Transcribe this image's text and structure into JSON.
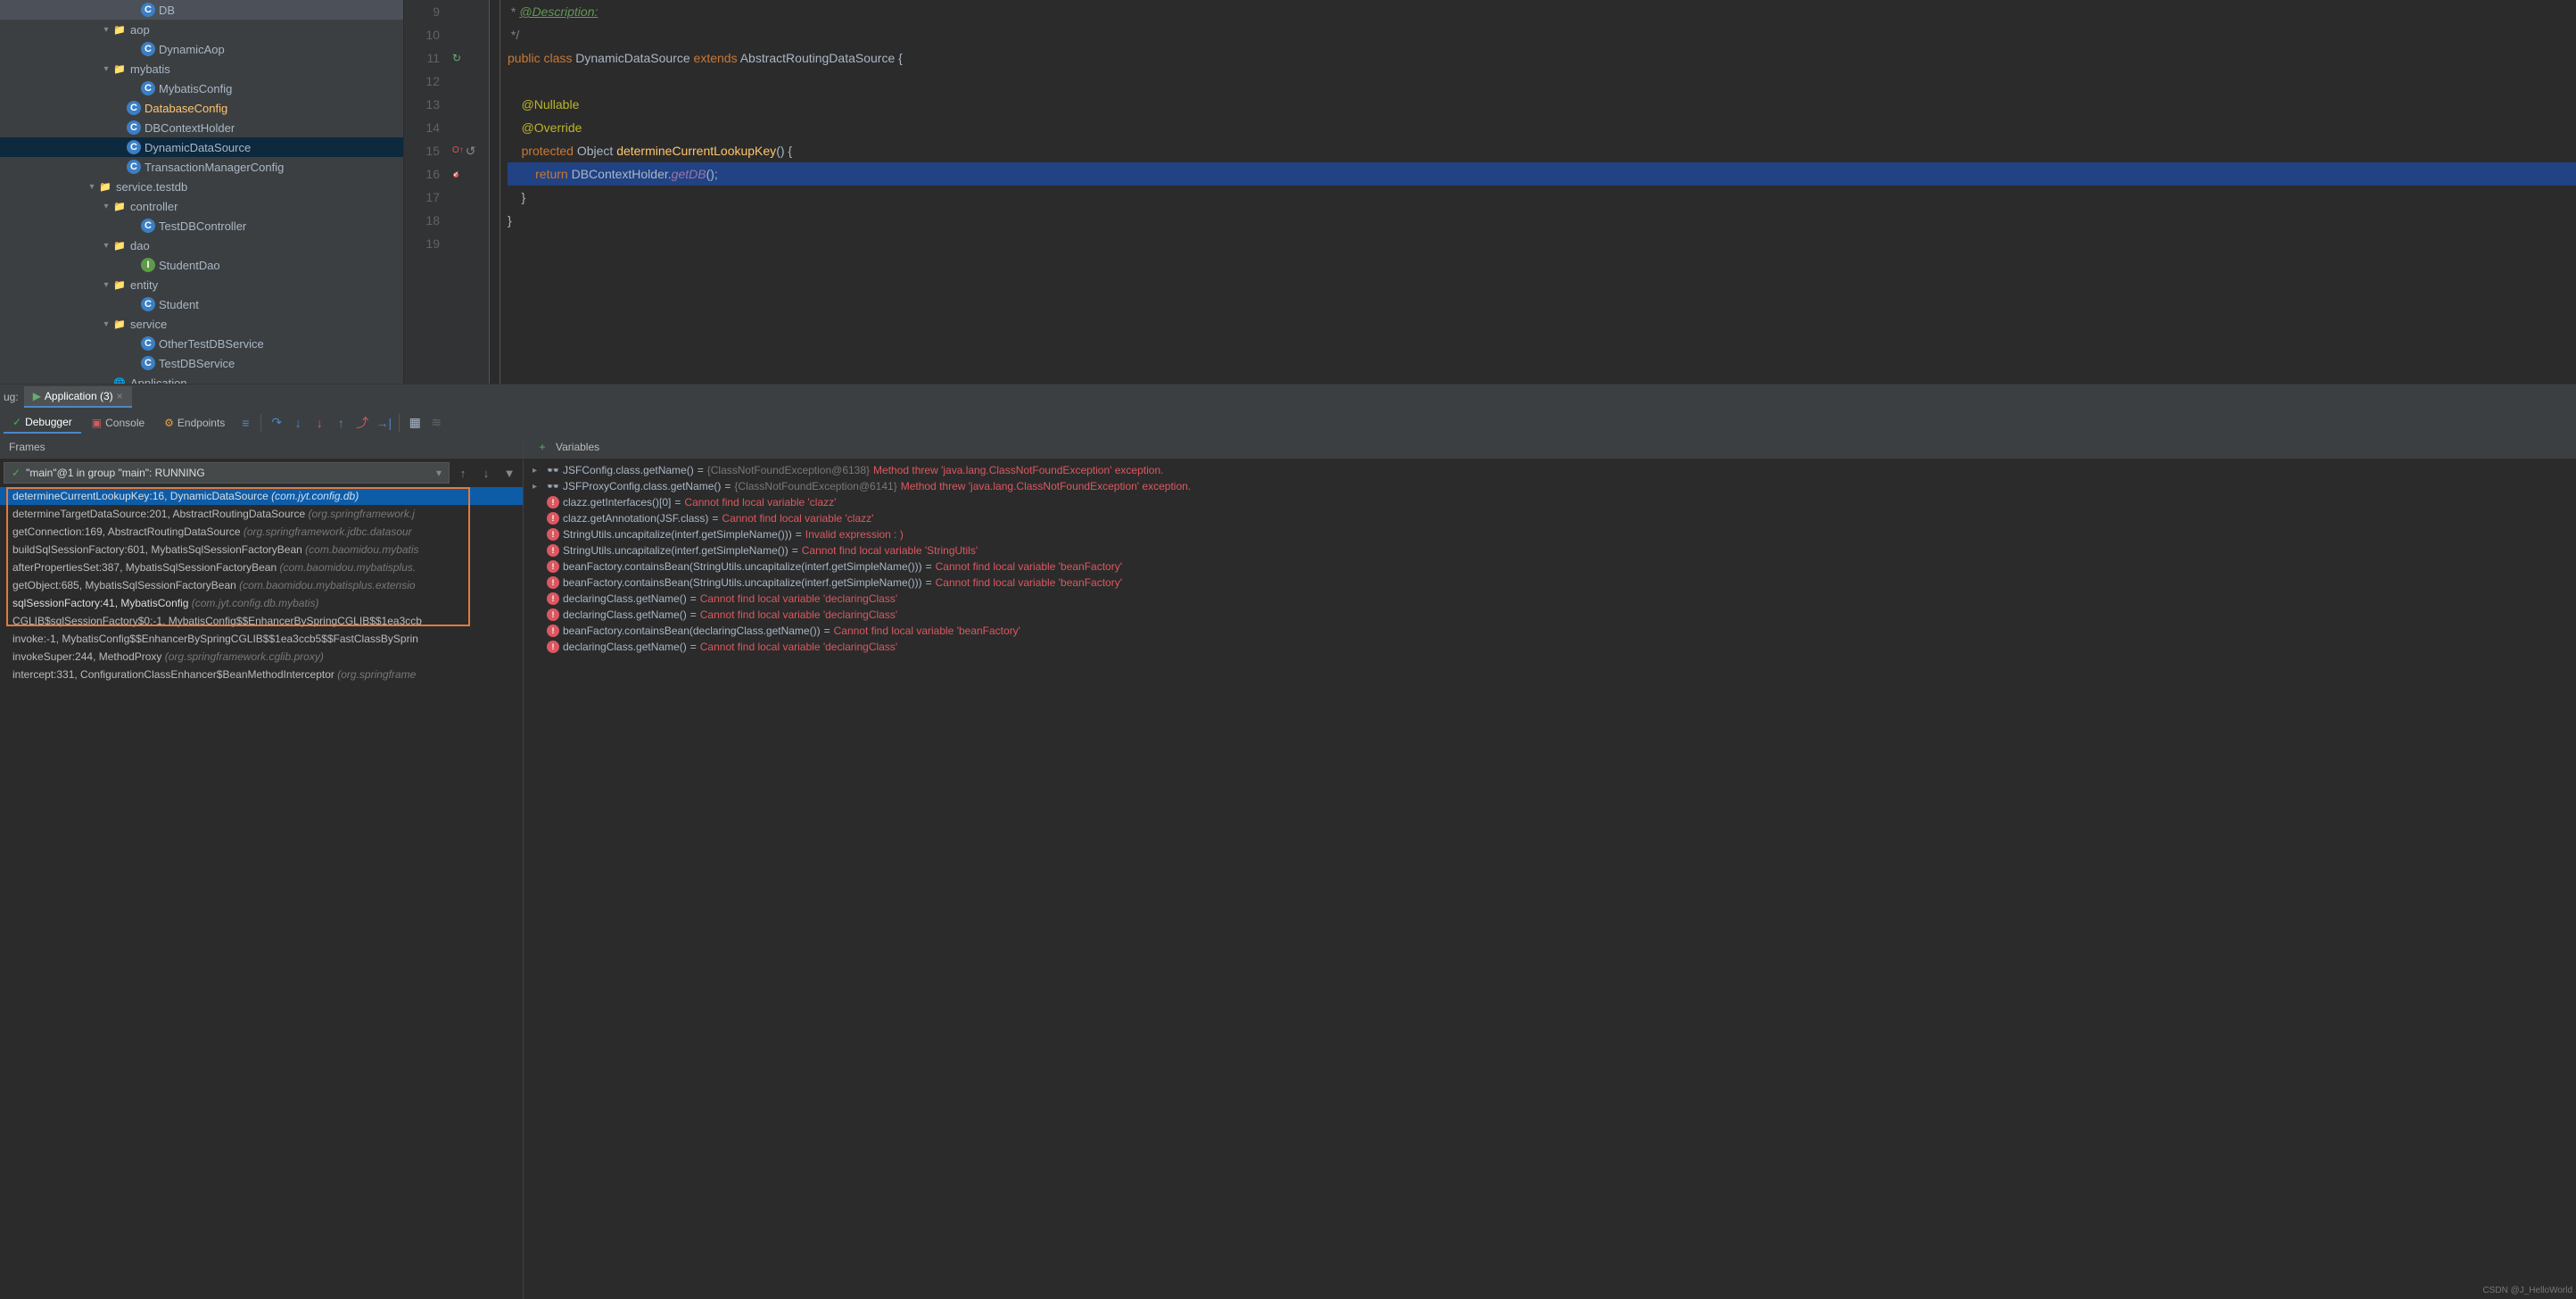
{
  "tree": {
    "items": [
      {
        "indent": 9,
        "chevron": "",
        "icon": "class-c",
        "iconText": "C",
        "label": "DB"
      },
      {
        "indent": 7,
        "chevron": "▾",
        "icon": "folder",
        "iconText": "📁",
        "label": "aop"
      },
      {
        "indent": 9,
        "chevron": "",
        "icon": "class-c",
        "iconText": "C",
        "label": "DynamicAop"
      },
      {
        "indent": 7,
        "chevron": "▾",
        "icon": "folder",
        "iconText": "📁",
        "label": "mybatis"
      },
      {
        "indent": 9,
        "chevron": "",
        "icon": "class-c",
        "iconText": "C",
        "label": "MybatisConfig"
      },
      {
        "indent": 8,
        "chevron": "",
        "icon": "class-c",
        "iconText": "C",
        "label": "DatabaseConfig",
        "highlighted": true
      },
      {
        "indent": 8,
        "chevron": "",
        "icon": "class-c",
        "iconText": "C",
        "label": "DBContextHolder"
      },
      {
        "indent": 8,
        "chevron": "",
        "icon": "class-c",
        "iconText": "C",
        "label": "DynamicDataSource",
        "selected": true
      },
      {
        "indent": 8,
        "chevron": "",
        "icon": "class-c",
        "iconText": "C",
        "label": "TransactionManagerConfig"
      },
      {
        "indent": 6,
        "chevron": "▾",
        "icon": "folder",
        "iconText": "📁",
        "label": "service.testdb"
      },
      {
        "indent": 7,
        "chevron": "▾",
        "icon": "folder",
        "iconText": "📁",
        "label": "controller"
      },
      {
        "indent": 9,
        "chevron": "",
        "icon": "class-c",
        "iconText": "C",
        "label": "TestDBController"
      },
      {
        "indent": 7,
        "chevron": "▾",
        "icon": "folder",
        "iconText": "📁",
        "label": "dao"
      },
      {
        "indent": 9,
        "chevron": "",
        "icon": "interface",
        "iconText": "I",
        "label": "StudentDao"
      },
      {
        "indent": 7,
        "chevron": "▾",
        "icon": "folder",
        "iconText": "📁",
        "label": "entity"
      },
      {
        "indent": 9,
        "chevron": "",
        "icon": "class-c",
        "iconText": "C",
        "label": "Student"
      },
      {
        "indent": 7,
        "chevron": "▾",
        "icon": "folder",
        "iconText": "📁",
        "label": "service"
      },
      {
        "indent": 9,
        "chevron": "",
        "icon": "class-c",
        "iconText": "C",
        "label": "OtherTestDBService"
      },
      {
        "indent": 9,
        "chevron": "",
        "icon": "class-c",
        "iconText": "C",
        "label": "TestDBService"
      },
      {
        "indent": 7,
        "chevron": "",
        "icon": "special",
        "iconText": "▶",
        "label": "Application"
      }
    ]
  },
  "editor": {
    "lines": [
      {
        "num": "9",
        "tokens": [
          {
            "t": "comment",
            "v": " * "
          },
          {
            "t": "doc-tag",
            "v": "@Description:"
          }
        ]
      },
      {
        "num": "10",
        "tokens": [
          {
            "t": "comment",
            "v": " */"
          }
        ]
      },
      {
        "num": "11",
        "gutter": "impl-down",
        "tokens": [
          {
            "t": "keyword",
            "v": "public class "
          },
          {
            "t": "class",
            "v": "DynamicDataSource "
          },
          {
            "t": "keyword",
            "v": "extends "
          },
          {
            "t": "class",
            "v": "AbstractRoutingDataSource {"
          }
        ]
      },
      {
        "num": "12",
        "tokens": []
      },
      {
        "num": "13",
        "tokens": [
          {
            "t": "plain",
            "v": "    "
          },
          {
            "t": "anno",
            "v": "@Nullable"
          }
        ]
      },
      {
        "num": "14",
        "tokens": [
          {
            "t": "plain",
            "v": "    "
          },
          {
            "t": "anno",
            "v": "@Override"
          }
        ]
      },
      {
        "num": "15",
        "gutter": "override",
        "tokens": [
          {
            "t": "plain",
            "v": "    "
          },
          {
            "t": "keyword",
            "v": "protected "
          },
          {
            "t": "class",
            "v": "Object "
          },
          {
            "t": "method",
            "v": "determineCurrentLookupKey"
          },
          {
            "t": "class",
            "v": "() {"
          }
        ]
      },
      {
        "num": "16",
        "gutter": "breakpoint",
        "highlighted": true,
        "tokens": [
          {
            "t": "plain",
            "v": "        "
          },
          {
            "t": "return",
            "v": "return "
          },
          {
            "t": "class",
            "v": "DBContextHolder."
          },
          {
            "t": "static",
            "v": "getDB"
          },
          {
            "t": "class",
            "v": "();"
          }
        ]
      },
      {
        "num": "17",
        "tokens": [
          {
            "t": "plain",
            "v": "    }"
          }
        ]
      },
      {
        "num": "18",
        "tokens": [
          {
            "t": "plain",
            "v": "}"
          }
        ]
      },
      {
        "num": "19",
        "tokens": []
      }
    ]
  },
  "debug_tab_prefix": "ug:",
  "debug_tab": "Application (3)",
  "toolbar_tabs": [
    "Debugger",
    "Console",
    "Endpoints"
  ],
  "frames": {
    "title": "Frames",
    "thread": "\"main\"@1 in group \"main\": RUNNING",
    "rows": [
      {
        "loc": "determineCurrentLookupKey:16, DynamicDataSource",
        "pkg": "(com.jyt.config.db)",
        "selected": true,
        "bold": true
      },
      {
        "loc": "determineTargetDataSource:201, AbstractRoutingDataSource",
        "pkg": "(org.springframework.j"
      },
      {
        "loc": "getConnection:169, AbstractRoutingDataSource",
        "pkg": "(org.springframework.jdbc.datasour"
      },
      {
        "loc": "buildSqlSessionFactory:601, MybatisSqlSessionFactoryBean",
        "pkg": "(com.baomidou.mybatis"
      },
      {
        "loc": "afterPropertiesSet:387, MybatisSqlSessionFactoryBean",
        "pkg": "(com.baomidou.mybatisplus."
      },
      {
        "loc": "getObject:685, MybatisSqlSessionFactoryBean",
        "pkg": "(com.baomidou.mybatisplus.extensio"
      },
      {
        "loc": "sqlSessionFactory:41, MybatisConfig",
        "pkg": "(com.jyt.config.db.mybatis)",
        "bold": true
      },
      {
        "loc": "CGLIB$sqlSessionFactory$0:-1, MybatisConfig$$EnhancerBySpringCGLIB$$1ea3ccb",
        "pkg": ""
      },
      {
        "loc": "invoke:-1, MybatisConfig$$EnhancerBySpringCGLIB$$1ea3ccb5$$FastClassBySprin",
        "pkg": ""
      },
      {
        "loc": "invokeSuper:244, MethodProxy",
        "pkg": "(org.springframework.cglib.proxy)"
      },
      {
        "loc": "intercept:331, ConfigurationClassEnhancer$BeanMethodInterceptor",
        "pkg": "(org.springframe"
      }
    ]
  },
  "variables": {
    "title": "Variables",
    "rows": [
      {
        "chevron": "▸",
        "icon": "glasses",
        "expr": "JSFConfig.class.getName()",
        "op": " = ",
        "obj": "{ClassNotFoundException@6138}",
        "err": " Method threw 'java.lang.ClassNotFoundException' exception."
      },
      {
        "chevron": "▸",
        "icon": "glasses",
        "expr": "JSFProxyConfig.class.getName()",
        "op": " = ",
        "obj": "{ClassNotFoundException@6141}",
        "err": " Method threw 'java.lang.ClassNotFoundException' exception."
      },
      {
        "chevron": "",
        "icon": "error",
        "expr": "clazz.getInterfaces()[0]",
        "op": " = ",
        "obj": "",
        "err": "Cannot find local variable 'clazz'"
      },
      {
        "chevron": "",
        "icon": "error",
        "expr": "clazz.getAnnotation(JSF.class)",
        "op": " = ",
        "obj": "",
        "err": "Cannot find local variable 'clazz'"
      },
      {
        "chevron": "",
        "icon": "error",
        "expr": "StringUtils.uncapitalize(interf.getSimpleName()))",
        "op": " = ",
        "obj": "",
        "err": "Invalid expression : )"
      },
      {
        "chevron": "",
        "icon": "error",
        "expr": "StringUtils.uncapitalize(interf.getSimpleName())",
        "op": " = ",
        "obj": "",
        "err": "Cannot find local variable 'StringUtils'"
      },
      {
        "chevron": "",
        "icon": "error",
        "expr": "beanFactory.containsBean(StringUtils.uncapitalize(interf.getSimpleName()))",
        "op": " = ",
        "obj": "",
        "err": "Cannot find local variable 'beanFactory'"
      },
      {
        "chevron": "",
        "icon": "error",
        "expr": "beanFactory.containsBean(StringUtils.uncapitalize(interf.getSimpleName()))",
        "op": " = ",
        "obj": "",
        "err": "Cannot find local variable 'beanFactory'"
      },
      {
        "chevron": "",
        "icon": "error",
        "expr": "declaringClass.getName()",
        "op": " = ",
        "obj": "",
        "err": "Cannot find local variable 'declaringClass'"
      },
      {
        "chevron": "",
        "icon": "error",
        "expr": "declaringClass.getName()",
        "op": " = ",
        "obj": "",
        "err": "Cannot find local variable 'declaringClass'"
      },
      {
        "chevron": "",
        "icon": "error",
        "expr": "beanFactory.containsBean(declaringClass.getName())",
        "op": " = ",
        "obj": "",
        "err": "Cannot find local variable 'beanFactory'"
      },
      {
        "chevron": "",
        "icon": "error",
        "expr": "declaringClass.getName()",
        "op": " = ",
        "obj": "",
        "err": "Cannot find local variable 'declaringClass'"
      }
    ]
  },
  "watermark": "CSDN @J_HelloWorld"
}
